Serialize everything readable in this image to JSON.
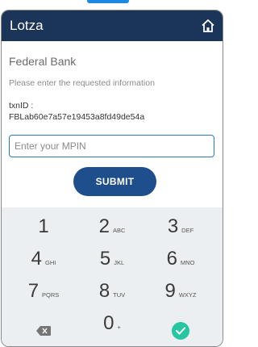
{
  "app": {
    "title": "Lotza"
  },
  "form": {
    "bank_name": "Federal Bank",
    "prompt": "Please enter the requested information",
    "txn_label": "txnID :",
    "txn_value": "FBLab60e7a57e19453a8fd49de54a",
    "mpin_placeholder": "Enter your MPIN",
    "submit_label": "SUBMIT"
  },
  "keypad": {
    "keys": [
      {
        "digit": "1",
        "letters": ""
      },
      {
        "digit": "2",
        "letters": "ABC"
      },
      {
        "digit": "3",
        "letters": "DEF"
      },
      {
        "digit": "4",
        "letters": "GHI"
      },
      {
        "digit": "5",
        "letters": "JKL"
      },
      {
        "digit": "6",
        "letters": "MNO"
      },
      {
        "digit": "7",
        "letters": "PQRS"
      },
      {
        "digit": "8",
        "letters": "TUV"
      },
      {
        "digit": "9",
        "letters": "WXYZ"
      }
    ],
    "zero": {
      "digit": "0",
      "letters": "+"
    },
    "backspace_icon": "backspace-icon",
    "done_icon": "check-icon",
    "accent": "#26c6a3"
  },
  "colors": {
    "appbar": "#1b3559",
    "submit": "#1e4e8c",
    "input_border": "#2a7ab8"
  }
}
